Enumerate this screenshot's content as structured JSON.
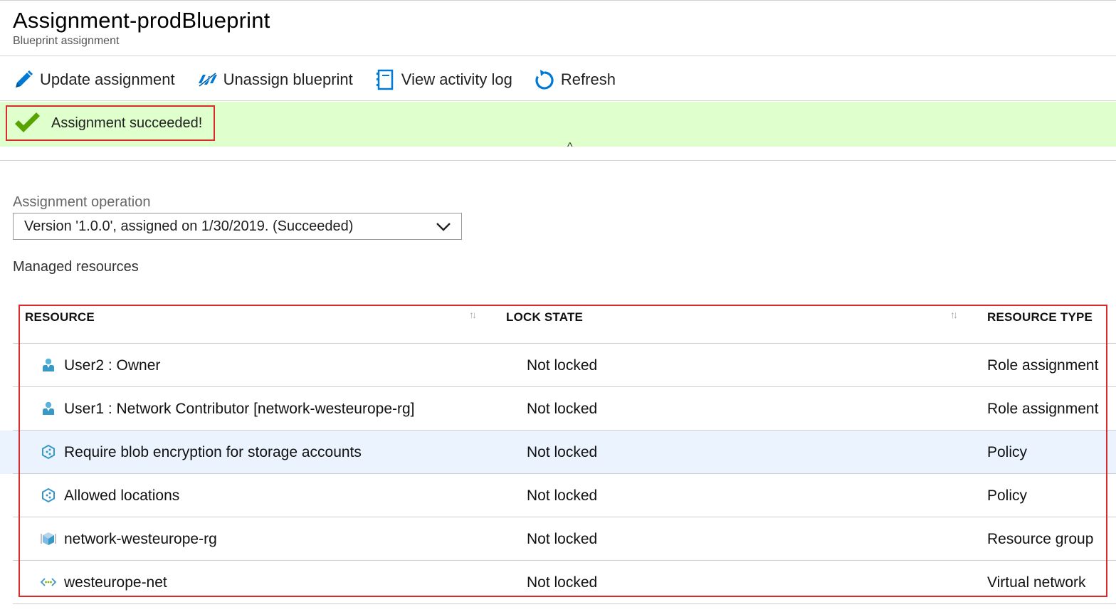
{
  "header": {
    "title": "Assignment-prodBlueprint",
    "subtitle": "Blueprint assignment"
  },
  "toolbar": {
    "update_label": "Update assignment",
    "unassign_label": "Unassign blueprint",
    "activity_label": "View activity log",
    "refresh_label": "Refresh"
  },
  "banner": {
    "message": "Assignment succeeded!",
    "collapse_glyph": "^"
  },
  "operation": {
    "label": "Assignment operation",
    "selected": "Version '1.0.0', assigned on 1/30/2019. (Succeeded)"
  },
  "managed": {
    "label": "Managed resources"
  },
  "table": {
    "columns": [
      "RESOURCE",
      "LOCK STATE",
      "RESOURCE TYPE"
    ],
    "sort_glyph": "↑↓",
    "rows": [
      {
        "icon": "user-icon",
        "resource": "User2 : Owner",
        "lock": "Not locked",
        "type": "Role assignment"
      },
      {
        "icon": "user-icon",
        "resource": "User1 : Network Contributor [network-westeurope-rg]",
        "lock": "Not locked",
        "type": "Role assignment"
      },
      {
        "icon": "policy-icon",
        "resource": "Require blob encryption for storage accounts",
        "lock": "Not locked",
        "type": "Policy"
      },
      {
        "icon": "policy-icon",
        "resource": "Allowed locations",
        "lock": "Not locked",
        "type": "Policy"
      },
      {
        "icon": "resource-group-icon",
        "resource": "network-westeurope-rg",
        "lock": "Not locked",
        "type": "Resource group"
      },
      {
        "icon": "virtual-network-icon",
        "resource": "westeurope-net",
        "lock": "Not locked",
        "type": "Virtual network"
      }
    ]
  },
  "colors": {
    "accent": "#0078d4",
    "success_bg": "#dfffcc",
    "success_check": "#57a300",
    "highlight_border": "#d92b2b",
    "row_selected": "#eaf3fe"
  }
}
